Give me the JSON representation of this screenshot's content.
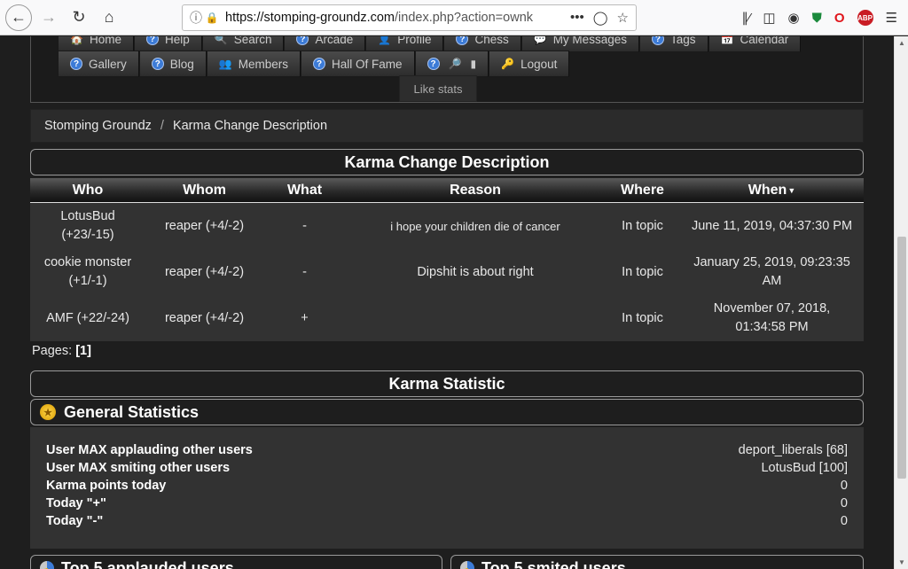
{
  "browser": {
    "url_host": "https://stomping-groundz.com",
    "url_path": "/index.php?action=ownk",
    "ellipsis": "•••"
  },
  "menu": {
    "row1": [
      "Home",
      "Help",
      "Search",
      "Arcade",
      "Profile",
      "Chess",
      "My Messages",
      "Tags",
      "Calendar"
    ],
    "row2": [
      "Gallery",
      "Blog",
      "Members",
      "Hall Of Fame"
    ],
    "logout": "Logout",
    "like_stats": "Like stats"
  },
  "breadcrumb": {
    "home": "Stomping Groundz",
    "separator": "/",
    "current": "Karma Change Description"
  },
  "karma_table": {
    "title": "Karma Change Description",
    "headers": [
      "Who",
      "Whom",
      "What",
      "Reason",
      "Where",
      "When"
    ],
    "rows": [
      {
        "who": "LotusBud",
        "who_score": "(+23/-15)",
        "whom": "reaper (+4/-2)",
        "what": "-",
        "reason": "i hope your children die of cancer",
        "where": "In topic",
        "when": "June 11, 2019, 04:37:30 PM"
      },
      {
        "who": "cookie monster",
        "who_score": "(+1/-1)",
        "whom": "reaper (+4/-2)",
        "what": "-",
        "reason": "Dipshit is about right",
        "where": "In topic",
        "when": "January 25, 2019, 09:23:35 AM"
      },
      {
        "who": "AMF",
        "who_score": "(+22/-24)",
        "whom": "reaper (+4/-2)",
        "what": "+",
        "reason": "",
        "where": "In topic",
        "when": "November 07, 2018, 01:34:58 PM"
      }
    ]
  },
  "pagination": {
    "label": "Pages:",
    "current": "[1]"
  },
  "karma_statistic": {
    "title": "Karma Statistic",
    "general_title": "General Statistics",
    "stats": [
      {
        "label": "User MAX applauding other users",
        "value": "deport_liberals [68]"
      },
      {
        "label": "User MAX smiting other users",
        "value": "LotusBud [100]"
      },
      {
        "label": "Karma points today",
        "value": "0"
      },
      {
        "label": "Today \"+\"",
        "value": "0"
      },
      {
        "label": "Today \"-\"",
        "value": "0"
      }
    ],
    "top_applauded": "Top 5 applauded users",
    "top_smited": "Top 5 smited users"
  }
}
